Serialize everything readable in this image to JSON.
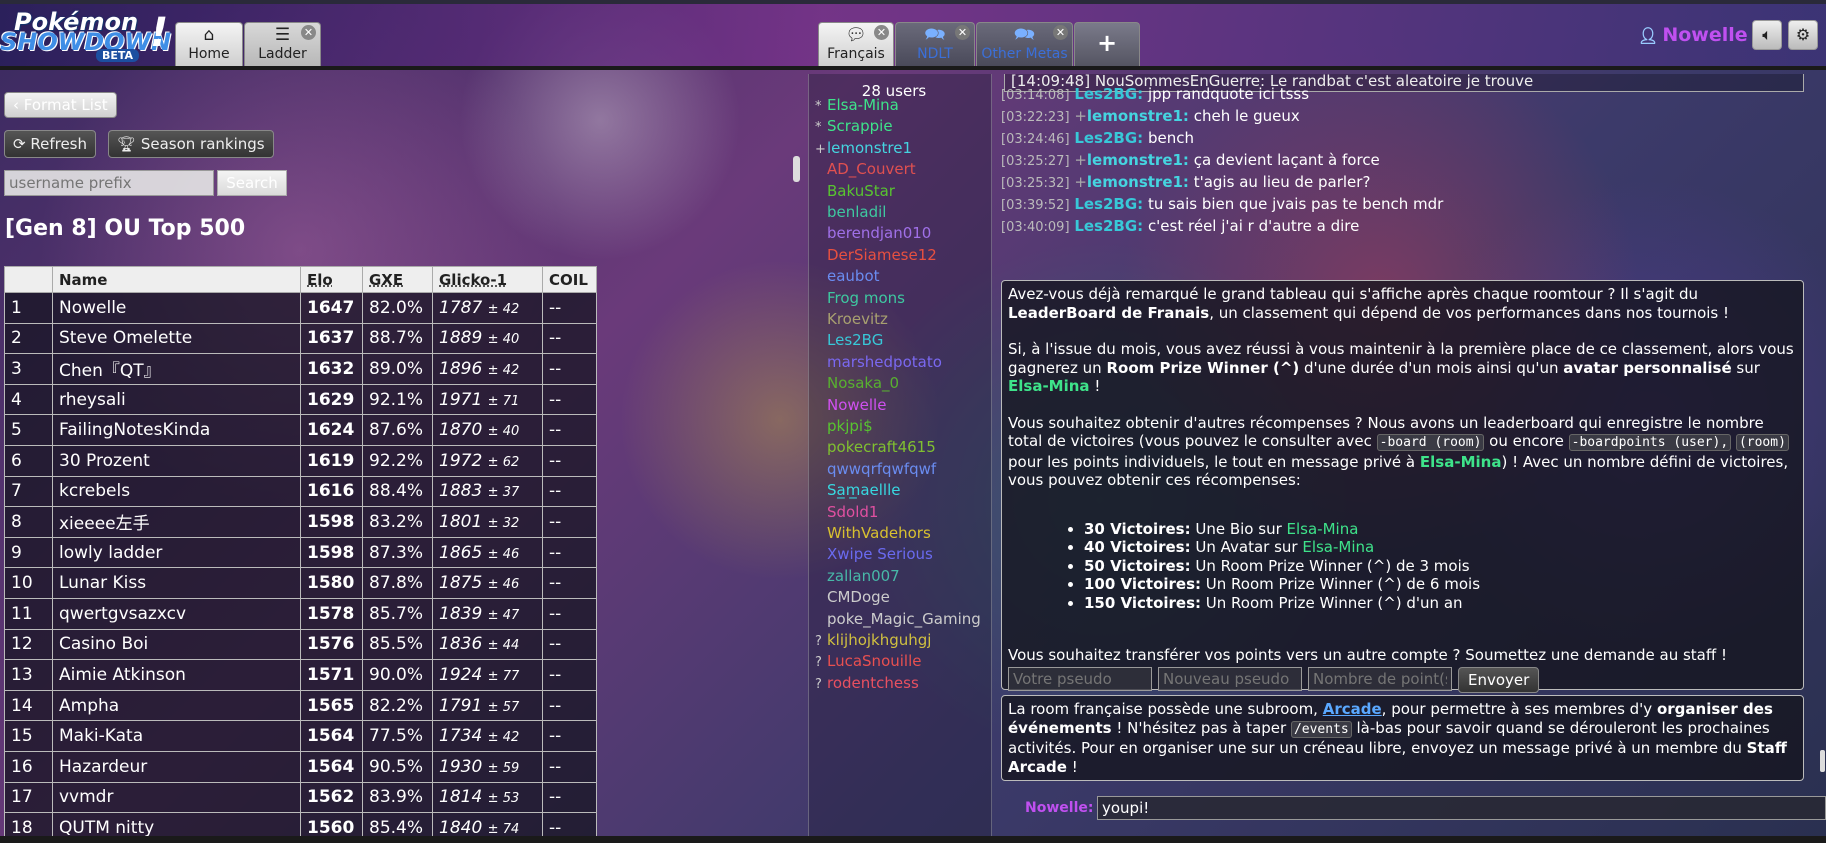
{
  "header": {
    "logo": {
      "line1": "Pokémon",
      "line2": "SHOWDOWN",
      "badge": "BETA",
      "bang": "!"
    },
    "nav": [
      {
        "label": "Home",
        "icon": "home-icon"
      },
      {
        "label": "Ladder",
        "icon": "list-icon"
      }
    ],
    "rooms": [
      {
        "label": "Français",
        "icon": "chat-bubble-icon"
      },
      {
        "label": "NDLT",
        "icon": "chat-bubbles-icon"
      },
      {
        "label": "Other Metas",
        "icon": "chat-bubbles-icon"
      }
    ],
    "add_label": "+",
    "username": "Nowelle"
  },
  "ladder": {
    "format_list_label": "Format List",
    "refresh_label": "Refresh",
    "season_label": "Season rankings",
    "search_placeholder": "username prefix",
    "search_label": "Search",
    "title": "[Gen 8] OU Top 500",
    "columns": [
      "",
      "Name",
      "Elo",
      "GXE",
      "Glicko-1",
      "COIL"
    ],
    "rows": [
      {
        "rank": "1",
        "name": "Nowelle",
        "elo": "1647",
        "gxe": "82.0%",
        "glicko": "1787",
        "dev": "± 42",
        "coil": "--"
      },
      {
        "rank": "2",
        "name": "Steve Omelette",
        "elo": "1637",
        "gxe": "88.7%",
        "glicko": "1889",
        "dev": "± 40",
        "coil": "--"
      },
      {
        "rank": "3",
        "name": "Chen『QT』",
        "elo": "1632",
        "gxe": "89.0%",
        "glicko": "1896",
        "dev": "± 42",
        "coil": "--"
      },
      {
        "rank": "4",
        "name": "rheysali",
        "elo": "1629",
        "gxe": "92.1%",
        "glicko": "1971",
        "dev": "± 71",
        "coil": "--"
      },
      {
        "rank": "5",
        "name": "FailingNotesKinda",
        "elo": "1624",
        "gxe": "87.6%",
        "glicko": "1870",
        "dev": "± 40",
        "coil": "--"
      },
      {
        "rank": "6",
        "name": "30 Prozent",
        "elo": "1619",
        "gxe": "92.2%",
        "glicko": "1972",
        "dev": "± 62",
        "coil": "--"
      },
      {
        "rank": "7",
        "name": "kcrebels",
        "elo": "1616",
        "gxe": "88.4%",
        "glicko": "1883",
        "dev": "± 37",
        "coil": "--"
      },
      {
        "rank": "8",
        "name": "xieeee左手",
        "elo": "1598",
        "gxe": "83.2%",
        "glicko": "1801",
        "dev": "± 32",
        "coil": "--"
      },
      {
        "rank": "9",
        "name": "lowly ladder",
        "elo": "1598",
        "gxe": "87.3%",
        "glicko": "1865",
        "dev": "± 46",
        "coil": "--"
      },
      {
        "rank": "10",
        "name": "Lunar Kiss",
        "elo": "1580",
        "gxe": "87.8%",
        "glicko": "1875",
        "dev": "± 46",
        "coil": "--"
      },
      {
        "rank": "11",
        "name": "qwertgvsazxcv",
        "elo": "1578",
        "gxe": "85.7%",
        "glicko": "1839",
        "dev": "± 47",
        "coil": "--"
      },
      {
        "rank": "12",
        "name": "Casino Boi",
        "elo": "1576",
        "gxe": "85.5%",
        "glicko": "1836",
        "dev": "± 44",
        "coil": "--"
      },
      {
        "rank": "13",
        "name": "Aimie Atkinson",
        "elo": "1571",
        "gxe": "90.0%",
        "glicko": "1924",
        "dev": "± 77",
        "coil": "--"
      },
      {
        "rank": "14",
        "name": "Ampha",
        "elo": "1565",
        "gxe": "82.2%",
        "glicko": "1791",
        "dev": "± 57",
        "coil": "--"
      },
      {
        "rank": "15",
        "name": "Maki-Kata",
        "elo": "1564",
        "gxe": "77.5%",
        "glicko": "1734",
        "dev": "± 42",
        "coil": "--"
      },
      {
        "rank": "16",
        "name": "Hazardeur",
        "elo": "1564",
        "gxe": "90.5%",
        "glicko": "1930",
        "dev": "± 59",
        "coil": "--"
      },
      {
        "rank": "17",
        "name": "vvmdr",
        "elo": "1562",
        "gxe": "83.9%",
        "glicko": "1814",
        "dev": "± 53",
        "coil": "--"
      },
      {
        "rank": "18",
        "name": "QUTM nitty",
        "elo": "1560",
        "gxe": "85.4%",
        "glicko": "1840",
        "dev": "± 74",
        "coil": "--"
      }
    ]
  },
  "userlist": {
    "count": "28 users",
    "users": [
      {
        "rank": "*",
        "name": "Elsa-Mina",
        "color": "#3ee38a"
      },
      {
        "rank": "*",
        "name": "Scrappie",
        "color": "#3ee38a"
      },
      {
        "rank": "+",
        "name": "lemonstre1",
        "color": "#45d4e0"
      },
      {
        "rank": "",
        "name": "AD_Couvert",
        "color": "#e05050"
      },
      {
        "rank": "",
        "name": "BakuStar",
        "color": "#58c430"
      },
      {
        "rank": "",
        "name": "benladil",
        "color": "#3ec8a0"
      },
      {
        "rank": "",
        "name": "berendjan010",
        "color": "#a070e8"
      },
      {
        "rank": "",
        "name": "DerSiamese12",
        "color": "#e85040"
      },
      {
        "rank": "",
        "name": "eaubot",
        "color": "#6a8cf0"
      },
      {
        "rank": "",
        "name": "Frog mons",
        "color": "#3ec8a0"
      },
      {
        "rank": "",
        "name": "Kroevitz",
        "color": "#a8a070"
      },
      {
        "rank": "",
        "name": "Les2BG",
        "color": "#38c8d8"
      },
      {
        "rank": "",
        "name": "marshedpotato",
        "color": "#7a68f0"
      },
      {
        "rank": "",
        "name": "Nosaka_0",
        "color": "#58b030"
      },
      {
        "rank": "",
        "name": "Nowelle",
        "color": "#d050f0"
      },
      {
        "rank": "",
        "name": "pkjpi$",
        "color": "#58c430"
      },
      {
        "rank": "",
        "name": "pokecraft4615",
        "color": "#80c030"
      },
      {
        "rank": "",
        "name": "qwwqrfqwfqwf",
        "color": "#6a8cf0"
      },
      {
        "rank": "",
        "name": "Sa̲m̲aellle",
        "color": "#38d8e0"
      },
      {
        "rank": "",
        "name": "Sdold1",
        "color": "#e050a0"
      },
      {
        "rank": "",
        "name": "WithVadehors",
        "color": "#d8c030"
      },
      {
        "rank": "",
        "name": "Xwipe Serious",
        "color": "#6a6af0"
      },
      {
        "rank": "",
        "name": "zallan007",
        "color": "#48b8a8"
      },
      {
        "rank": "",
        "name": "CMDoge",
        "color": "#cccccc"
      },
      {
        "rank": "",
        "name": "poke_Magic_Gaming",
        "color": "#cccccc"
      },
      {
        "rank": "?",
        "name": "klijhojkhguhgj",
        "color": "#d0c040"
      },
      {
        "rank": "?",
        "name": "LucaSnouille",
        "color": "#e85050"
      },
      {
        "rank": "?",
        "name": "rodentchess",
        "color": "#e85060"
      }
    ]
  },
  "chat": {
    "topline": "[14:09:48] NouSommesEnGuerre: Le randbat c'est aleatoire je trouve",
    "messages": [
      {
        "ts": "[03:14:08]",
        "rank": "",
        "name": "Les2BG:",
        "color": "#38c8d8",
        "text": "jpp randquote ici tsss"
      },
      {
        "ts": "[03:22:23]",
        "rank": "+",
        "name": "lemonstre1:",
        "color": "#45d4e0",
        "text": "cheh le gueux"
      },
      {
        "ts": "[03:24:46]",
        "rank": "",
        "name": "Les2BG:",
        "color": "#38c8d8",
        "text": "bench"
      },
      {
        "ts": "[03:25:27]",
        "rank": "+",
        "name": "lemonstre1:",
        "color": "#45d4e0",
        "text": "ça devient laçant à force"
      },
      {
        "ts": "[03:25:32]",
        "rank": "+",
        "name": "lemonstre1:",
        "color": "#45d4e0",
        "text": "t'agis au lieu de parler?"
      },
      {
        "ts": "[03:39:52]",
        "rank": "",
        "name": "Les2BG:",
        "color": "#38c8d8",
        "text": "tu sais bien que jvais pas te bench mdr"
      },
      {
        "ts": "[03:40:09]",
        "rank": "",
        "name": "Les2BG:",
        "color": "#38c8d8",
        "text": "c'est réel j'ai r d'autre a dire"
      }
    ],
    "announce1": {
      "p1a": "Avez-vous déjà remarqué le grand tableau qui s'affiche après chaque roomtour ? Il s'agit du ",
      "p1b": "LeaderBoard de Franais",
      "p1c": ", un classement qui dépend de vos performances dans nos tournois !",
      "p2a": "Si, à l'issue du mois, vous avez réussi à vous maintenir à la première place de ce classement, alors vous gagnerez un ",
      "p2b": "Room Prize Winner (^)",
      "p2c": " d'une durée d'un mois ainsi qu'un ",
      "p2d": "avatar personnalisé",
      "p2e": " sur ",
      "p2f": "Elsa-Mina",
      "p2g": " !",
      "p3a": "Vous souhaitez obtenir d'autres récompenses ? Nous avons un leaderboard qui enregistre le nombre total de victoires (vous pouvez le consulter avec ",
      "p3code1": "-board (room)",
      "p3b": " ou encore ",
      "p3code2": "-boardpoints (user),",
      "p3code3": "(room)",
      "p3c": " pour les points individuels, le tout en message privé à ",
      "p3d": "Elsa-Mina",
      "p3e": ") ! Avec un nombre défini de victoires, vous pouvez obtenir ces récompenses:",
      "rewards": [
        {
          "b": "30 Victoires:",
          "t": " Une Bio sur ",
          "n": "Elsa-Mina"
        },
        {
          "b": "40 Victoires:",
          "t": " Un Avatar sur ",
          "n": "Elsa-Mina"
        },
        {
          "b": "50 Victoires:",
          "t": " Un Room Prize Winner (^) de 3 mois",
          "n": ""
        },
        {
          "b": "100 Victoires:",
          "t": " Un Room Prize Winner (^) de 6 mois",
          "n": ""
        },
        {
          "b": "150 Victoires:",
          "t": " Un Room Prize Winner (^) d'un an",
          "n": ""
        }
      ],
      "p4": "Vous souhaitez transférer vos points vers un autre compte ? Soumettez une demande au staff !",
      "form": {
        "pseudo_placeholder": "Votre pseudo",
        "new_pseudo_placeholder": "Nouveau pseudo",
        "points_placeholder": "Nombre de point(s)",
        "send_label": "Envoyer"
      }
    },
    "announce2": {
      "a": "La room française possède une subroom, ",
      "link": "Arcade",
      "b": ", pour permettre à ses membres d'y ",
      "c": "organiser des événements",
      "d": " ! N'hésitez pas à taper ",
      "code": "/events",
      "e": " là-bas pour savoir quand se dérouleront les prochaines activités. Pour en organiser une sur un créneau libre, envoyez un message privé à un membre du ",
      "f": "Staff Arcade",
      "g": " !"
    },
    "compose_name": "Nowelle:",
    "compose_value": "youpi!"
  }
}
